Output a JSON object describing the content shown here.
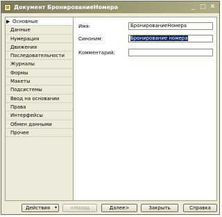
{
  "window": {
    "title": "Документ БронированиеНомера",
    "controls": [
      "_",
      "□",
      "✕"
    ]
  },
  "nav": {
    "items": [
      "Основные",
      "Данные",
      "Нумерация",
      "Движения",
      "Последовательности",
      "Журналы",
      "Формы",
      "Макеты",
      "Подсистемы",
      "Ввод на основании",
      "Права",
      "Интерфейсы",
      "Обмен данными",
      "Прочее"
    ]
  },
  "form": {
    "name_label": "Имя:",
    "name_value": "БронированиеНомера",
    "synonym_label": "Синоним:",
    "synonym_value": "Бронирование номера",
    "comment_label": "Комментарий:",
    "comment_value": ""
  },
  "footer": {
    "actions_label": "Действия",
    "actions_dropdown": "▾",
    "back_label": "<Назад",
    "next_label": "Далее>",
    "close_label": "Закрыть",
    "help_label": "Справка"
  },
  "colors": {
    "selection": "#0a246a",
    "window_bg": "#ecebd9",
    "title_bar": "#8c8a66"
  }
}
